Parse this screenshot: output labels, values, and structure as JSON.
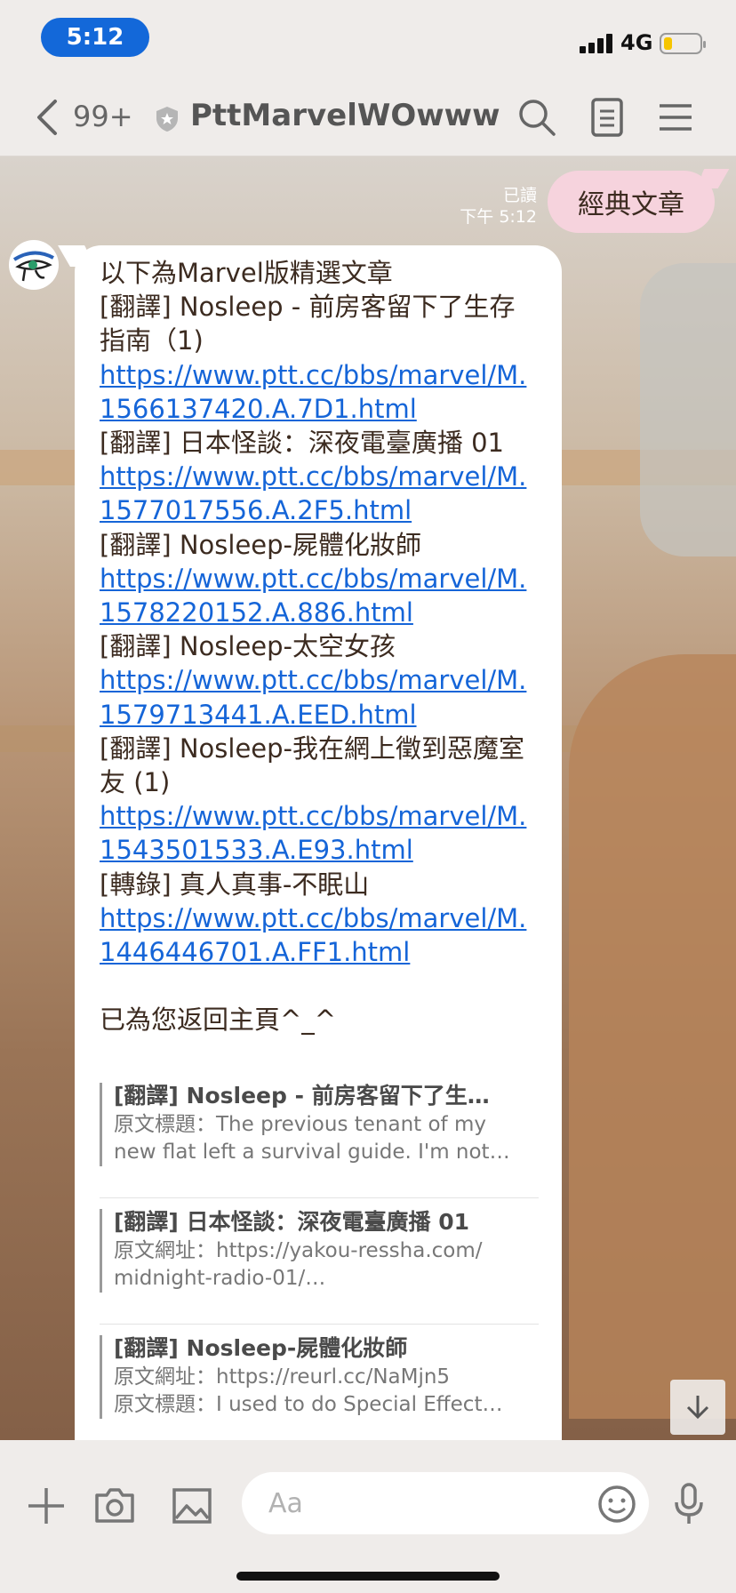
{
  "status_bar": {
    "time": "5:12",
    "network": "4G",
    "battery_icon": "battery-icon",
    "signal_icon": "signal-icon"
  },
  "header": {
    "back_icon": "chevron-left-icon",
    "unread_count": "99+",
    "title": "PttMarvelWOwww",
    "verified_icon": "shield-icon",
    "actions": [
      "search-icon",
      "notes-icon",
      "menu-icon"
    ]
  },
  "chat": {
    "outgoing": {
      "text": "經典文章",
      "read": "已讀",
      "time": "下午 5:12"
    },
    "incoming": {
      "lines": [
        {
          "text": "以下為Marvel版精選文章",
          "link": false
        },
        {
          "text": "[翻譯] Nosleep - 前房客留下了生存指南（1)",
          "link": false
        },
        {
          "text": "https://www.ptt.cc/bbs/marvel/M.1566137420.A.7D1.html",
          "link": true
        },
        {
          "text": "[翻譯] 日本怪談：深夜電臺廣播 01",
          "link": false
        },
        {
          "text": " https://www.ptt.cc/bbs/marvel/M.1577017556.A.2F5.html",
          "link": true
        },
        {
          "text": "[翻譯] Nosleep-屍體化妝師",
          "link": false
        },
        {
          "text": " https://www.ptt.cc/bbs/marvel/M.1578220152.A.886.html",
          "link": true
        },
        {
          "text": "[翻譯] Nosleep-太空女孩",
          "link": false
        },
        {
          "text": " https://www.ptt.cc/bbs/marvel/M.1579713441.A.EED.html",
          "link": true
        },
        {
          "text": "[翻譯] Nosleep-我在網上徵到惡魔室友 (1)",
          "link": false
        },
        {
          "text": " https://www.ptt.cc/bbs/marvel/M.1543501533.A.E93.html",
          "link": true
        },
        {
          "text": "[轉錄] 真人真事-不眠山",
          "link": false
        },
        {
          "text": " https://www.ptt.cc/bbs/marvel/M.1446446701.A.FF1.html",
          "link": true
        }
      ],
      "closing": "已為您返回主頁^_^"
    },
    "previews": [
      {
        "title": "[翻譯] Nosleep - 前房客留下了生…",
        "desc": [
          "原文標題：The previous tenant of my",
          "new flat left a survival guide. I'm not…"
        ]
      },
      {
        "title": "[翻譯] 日本怪談：深夜電臺廣播 01",
        "desc": [
          "原文網址：https://yakou-ressha.com/",
          "midnight-radio-01/…"
        ]
      },
      {
        "title": "[翻譯] Nosleep-屍體化妝師",
        "desc": [
          "原文網址：https://reurl.cc/NaMjn5",
          "原文標題：I used to do Special Effect…"
        ]
      }
    ]
  },
  "input_bar": {
    "placeholder": "Aa",
    "icons": [
      "plus-icon",
      "camera-icon",
      "image-icon",
      "emoji-icon",
      "mic-icon"
    ]
  },
  "colors": {
    "accent": "#1368d9",
    "link": "#1565d8",
    "outgoing_bubble": "#f6d3dd"
  }
}
